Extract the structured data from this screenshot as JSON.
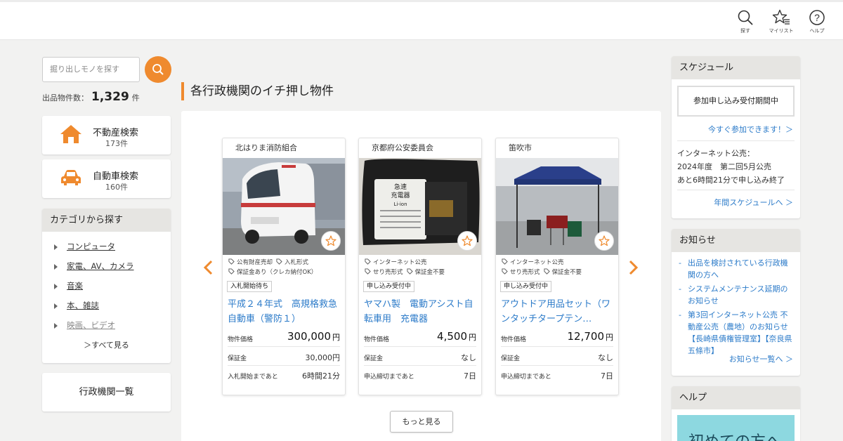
{
  "header": {
    "search_label": "探す",
    "mylist_label": "マイリスト",
    "help_label": "ヘルプ"
  },
  "sidebar": {
    "search_placeholder": "掘り出しモノを探す",
    "count_label": "出品物件数：",
    "count_value": "1,329",
    "count_unit": "件",
    "realestate": {
      "label": "不動産検索",
      "count": "173件"
    },
    "car": {
      "label": "自動車検索",
      "count": "160件"
    },
    "category": {
      "heading": "カテゴリから探す",
      "items": [
        {
          "label": "コンピュータ"
        },
        {
          "label": "家電、AV、カメラ"
        },
        {
          "label": "音楽"
        },
        {
          "label": "本、雑誌"
        },
        {
          "label": "映画、ビデオ"
        }
      ],
      "see_all": "＞すべて見る"
    },
    "gov_list": "行政機関一覧"
  },
  "main": {
    "section_title": "各行政機関のイチ押し物件",
    "more_button": "もっと見る",
    "cards": [
      {
        "org": "北はりま消防組合",
        "tags": [
          "公有財産売却",
          "入札形式",
          "保証金あり（クレカ納付OK）"
        ],
        "status": "入札開始待ち",
        "title": "平成２４年式　高規格救急自動車（警防１）",
        "price_label": "物件価格",
        "price": "300,000",
        "price_unit": "円",
        "deposit_label": "保証金",
        "deposit": "30,000円",
        "time_label": "入札開始まであと",
        "time": "6時間21分"
      },
      {
        "org": "京都府公安委員会",
        "tags": [
          "インターネット公売",
          "せり売形式",
          "保証金不要"
        ],
        "status": "申し込み受付中",
        "title": "ヤマハ製　電動アシスト自転車用　充電器",
        "price_label": "物件価格",
        "price": "4,500",
        "price_unit": "円",
        "deposit_label": "保証金",
        "deposit": "なし",
        "time_label": "申込締切まであと",
        "time": "7日",
        "photo_text": [
          "急速",
          "充電器",
          "Li-ion"
        ]
      },
      {
        "org": "笛吹市",
        "tags": [
          "インターネット公売",
          "せり売形式",
          "保証金不要"
        ],
        "status": "申し込み受付中",
        "title": "アウトドア用品セット（ワンタッチタープテン…",
        "price_label": "物件価格",
        "price": "12,700",
        "price_unit": "円",
        "deposit_label": "保証金",
        "deposit": "なし",
        "time_label": "申込締切まであと",
        "time": "7日"
      }
    ]
  },
  "schedule": {
    "heading": "スケジュール",
    "apply_button": "参加申し込み受付期間中",
    "join_link": "今すぐ参加できます！＞",
    "line1": "インターネット公売：",
    "line2": "2024年度　第二回5月公売",
    "line3": "あと6時間21分で申し込み終了",
    "annual_link": "年間スケジュールへ ＞"
  },
  "news": {
    "heading": "お知らせ",
    "items": [
      "出品を検討されている行政機関の方へ",
      "システムメンテナンス延期のお知らせ",
      "第3回インターネット公売 不動産公売（農地）のお知らせ【長崎県債権管理室】【奈良県五條市】"
    ],
    "list_link": "お知らせ一覧へ ＞"
  },
  "help": {
    "heading": "ヘルプ",
    "banner_text": "初めての方へ"
  },
  "colors": {
    "accent": "#ef8a2e",
    "link": "#2c7bc9"
  }
}
